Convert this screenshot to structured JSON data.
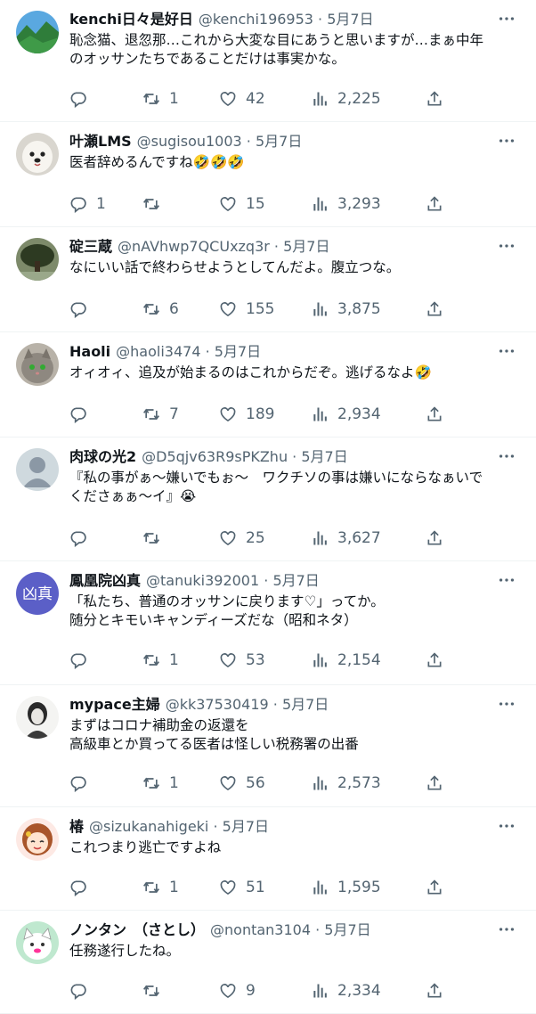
{
  "tweets": [
    {
      "name": "kenchi日々是好日",
      "handle": "@kenchi196953",
      "date": "5月7日",
      "lines": [
        "恥念猫、退忽那…これから大変な目にあうと思いますが…まぁ中年",
        "のオッサンたちであることだけは事実かな。"
      ],
      "replies": "",
      "retweets": "1",
      "likes": "42",
      "views": "2,225",
      "avatar": "landscape-photo"
    },
    {
      "name": "叶瀬LMS",
      "handle": "@sugisou1003",
      "date": "5月7日",
      "lines": [
        "医者辞めるんですね🤣🤣🤣"
      ],
      "replies": "1",
      "retweets": "",
      "likes": "15",
      "views": "3,293",
      "avatar": "white-dog-photo"
    },
    {
      "name": "碇三蔵",
      "handle": "@nAVhwp7QCUxzq3r",
      "date": "5月7日",
      "lines": [
        "なにいい話で終わらせようとしてんだよ。腹立つな。"
      ],
      "replies": "",
      "retweets": "6",
      "likes": "155",
      "views": "3,875",
      "avatar": "tree-photo"
    },
    {
      "name": "Haoli",
      "handle": "@haoli3474",
      "date": "5月7日",
      "lines": [
        "オィオィ、追及が始まるのはこれからだぞ。逃げるなよ🤣"
      ],
      "replies": "",
      "retweets": "7",
      "likes": "189",
      "views": "2,934",
      "avatar": "cat-photo"
    },
    {
      "name": "肉球の光2",
      "handle": "@D5qjv63R9sPKZhu",
      "date": "5月7日",
      "lines": [
        "『私の事がぁ〜嫌いでもぉ〜　ワクチソの事は嫌いにならなぁいで",
        "くださぁぁ〜イ』😭"
      ],
      "replies": "",
      "retweets": "",
      "likes": "25",
      "views": "3,627",
      "avatar": "default-avatar"
    },
    {
      "name": "鳳凰院凶真",
      "handle": "@tanuki392001",
      "date": "5月7日",
      "lines": [
        "「私たち、普通のオッサンに戻ります♡」ってか。",
        "随分とキモいキャンディーズだな（昭和ネタ）"
      ],
      "replies": "",
      "retweets": "1",
      "likes": "53",
      "views": "2,154",
      "avatar": "text-avatar",
      "avatar_text": "凶真",
      "avatar_color": "#5b5fc7"
    },
    {
      "name": "mypace主婦",
      "handle": "@kk37530419",
      "date": "5月7日",
      "lines": [
        "まずはコロナ補助金の返還を",
        "高級車とか買ってる医者は怪しい税務署の出番"
      ],
      "replies": "",
      "retweets": "1",
      "likes": "56",
      "views": "2,573",
      "avatar": "portrait-sketch"
    },
    {
      "name": "椿",
      "handle": "@sizukanahigeki",
      "date": "5月7日",
      "lines": [
        "これつまり逃亡ですよね"
      ],
      "replies": "",
      "retweets": "1",
      "likes": "51",
      "views": "1,595",
      "avatar": "anime-girl"
    },
    {
      "name": "ノンタン　（さとし）",
      "handle": "@nontan3104",
      "date": "5月7日",
      "lines": [
        "任務遂行したね。"
      ],
      "replies": "",
      "retweets": "",
      "likes": "9",
      "views": "2,334",
      "avatar": "cartoon-cat"
    }
  ],
  "colors": {
    "text": "#0f1419",
    "secondary": "#536471",
    "divider": "#eff3f4",
    "background": "#ffffff"
  },
  "icons": {
    "reply": "reply-icon",
    "retweet": "retweet-icon",
    "like": "heart-icon",
    "views": "views-chart-icon",
    "share": "share-icon",
    "more": "more-dots-icon"
  }
}
